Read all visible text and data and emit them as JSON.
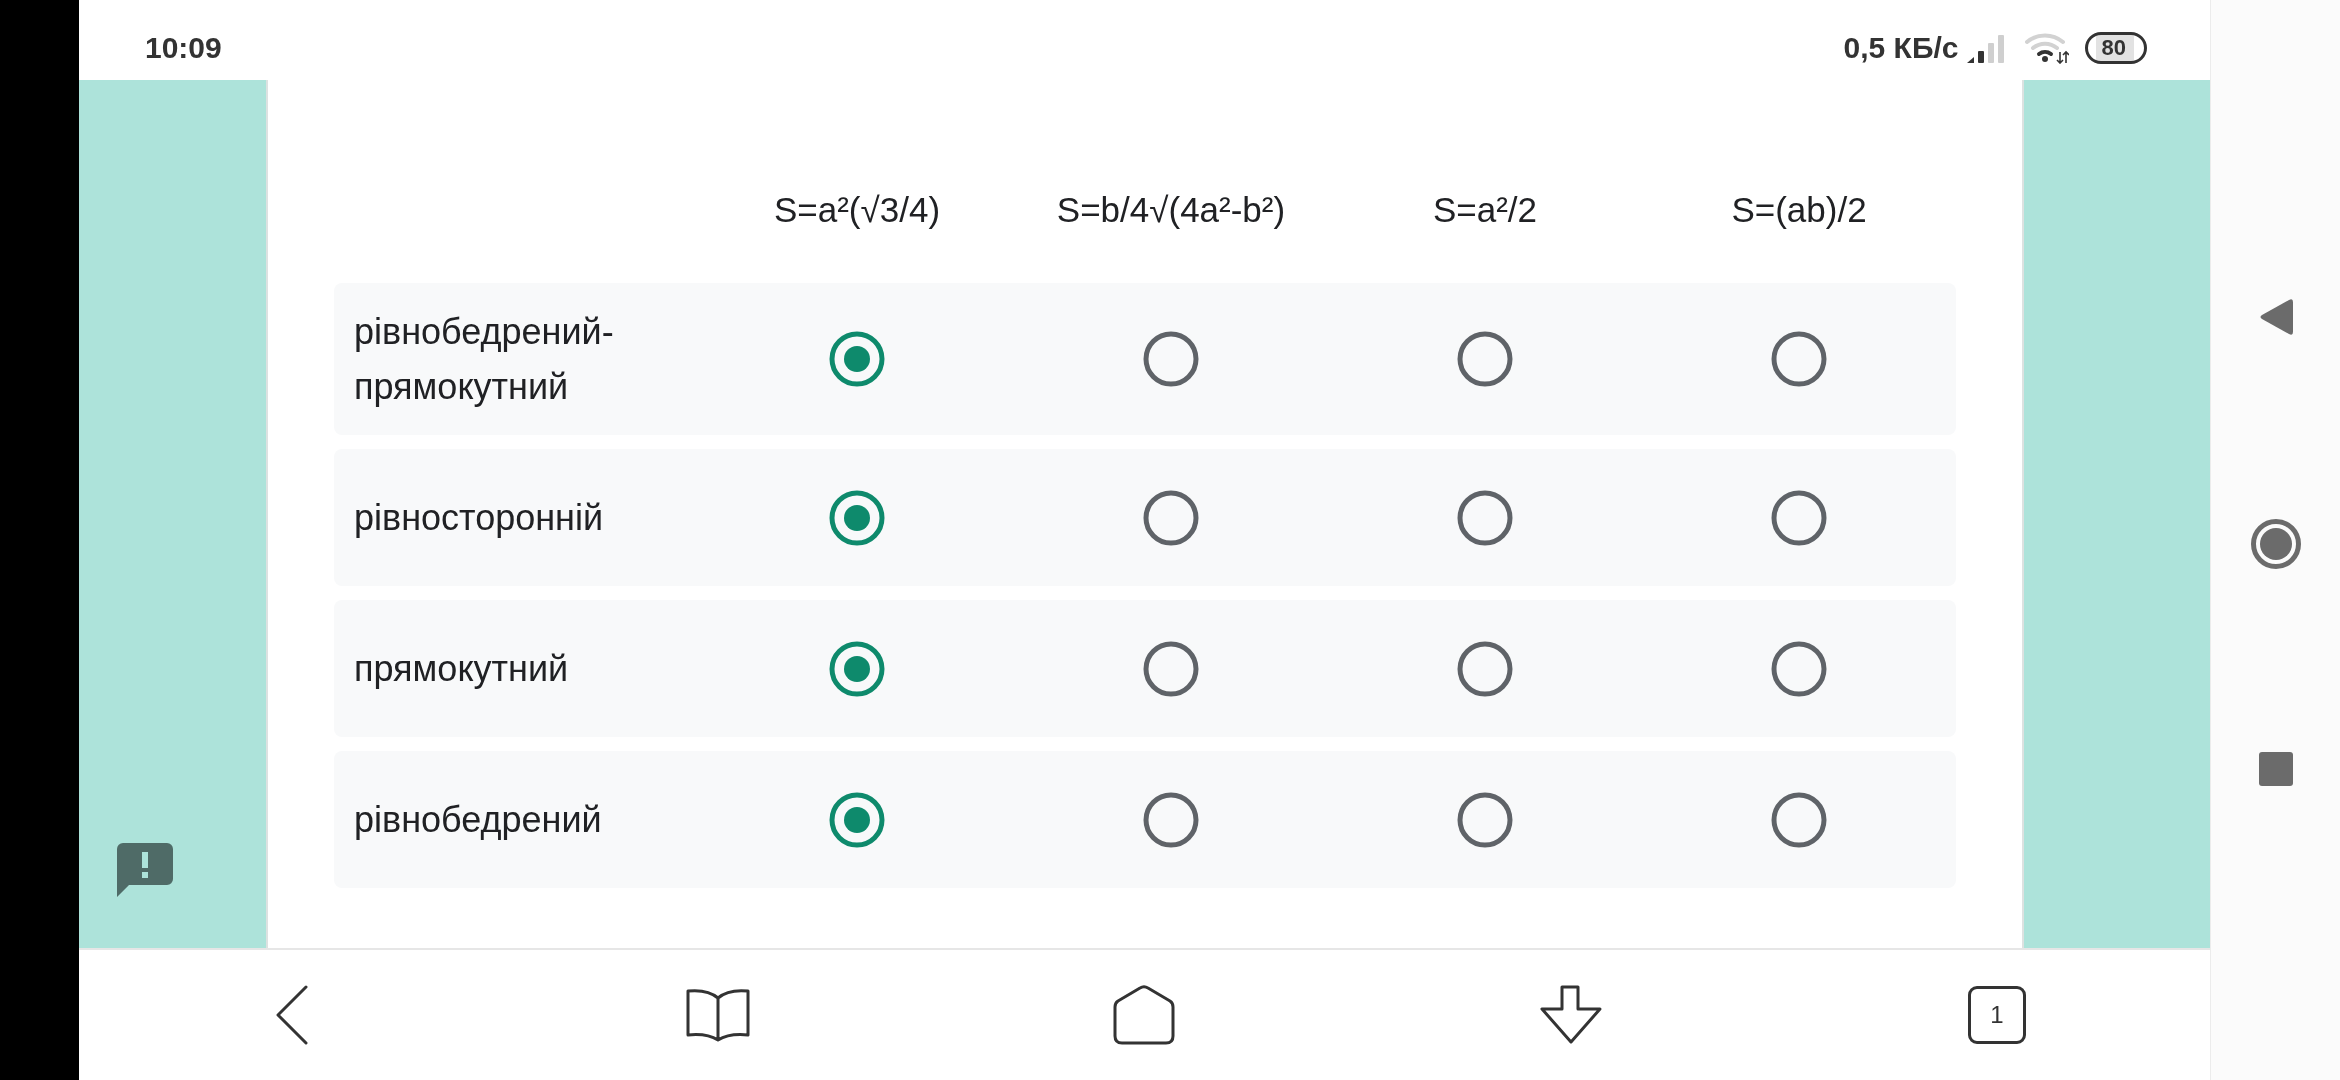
{
  "status_bar": {
    "time": "10:09",
    "network_speed": "0,5 КБ/с",
    "battery": "80"
  },
  "grid": {
    "columns": [
      "S=a²(√3/4)",
      "S=b/4√(4a²-b²)",
      "S=a²/2",
      "S=(ab)/2"
    ],
    "rows": [
      {
        "label": "рівнобедрений-прямокутний",
        "options": [
          {
            "selected": true
          },
          {
            "selected": false
          },
          {
            "selected": false
          },
          {
            "selected": false
          }
        ]
      },
      {
        "label": "рівносторонній",
        "options": [
          {
            "selected": true
          },
          {
            "selected": false
          },
          {
            "selected": false
          },
          {
            "selected": false
          }
        ]
      },
      {
        "label": "прямокутний",
        "options": [
          {
            "selected": true
          },
          {
            "selected": false
          },
          {
            "selected": false
          },
          {
            "selected": false
          }
        ]
      },
      {
        "label": "рівнобедрений",
        "options": [
          {
            "selected": true
          },
          {
            "selected": false
          },
          {
            "selected": false
          },
          {
            "selected": false
          }
        ]
      }
    ]
  },
  "browser_toolbar": {
    "tab_count": "1"
  }
}
